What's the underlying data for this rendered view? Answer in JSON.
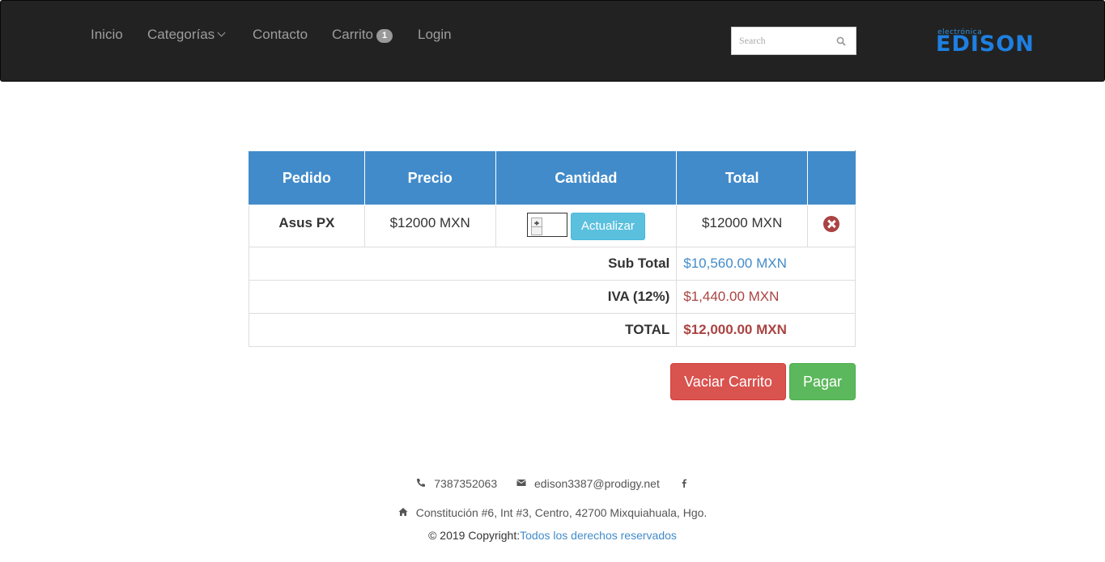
{
  "nav": {
    "items": [
      {
        "label": "Inicio"
      },
      {
        "label": "Categorías"
      },
      {
        "label": "Contacto"
      },
      {
        "label": "Carrito",
        "badge": "1"
      },
      {
        "label": "Login"
      }
    ],
    "search_placeholder": "Search",
    "logo_small": "electrónica",
    "logo_big": "EDISON"
  },
  "cart": {
    "headers": [
      "Pedido",
      "Precio",
      "Cantidad",
      "Total",
      ""
    ],
    "items": [
      {
        "name": "Asus PX",
        "price": "$12000 MXN",
        "quantity": "1",
        "update_label": "Actualizar",
        "total": "$12000 MXN"
      }
    ],
    "subtotal_label": "Sub Total",
    "subtotal_value": "$10,560.00 MXN",
    "iva_label": "IVA (12%)",
    "iva_value": "$1,440.00 MXN",
    "total_label": "TOTAL",
    "total_value": "$12,000.00 MXN"
  },
  "actions": {
    "empty_label": "Vaciar Carrito",
    "pay_label": "Pagar"
  },
  "footer": {
    "phone": "7387352063",
    "email": "edison3387@prodigy.net",
    "address": "Constitución #6, Int #3, Centro, 42700 Mixquiahuala, Hgo.",
    "copyright": "© 2019 Copyright:",
    "rights_link": "Todos los derechos reservados"
  },
  "colors": {
    "navbar": "#222222",
    "primary": "#428bca",
    "danger": "#d9534f",
    "success": "#5cb85c",
    "info": "#5bc0de"
  }
}
